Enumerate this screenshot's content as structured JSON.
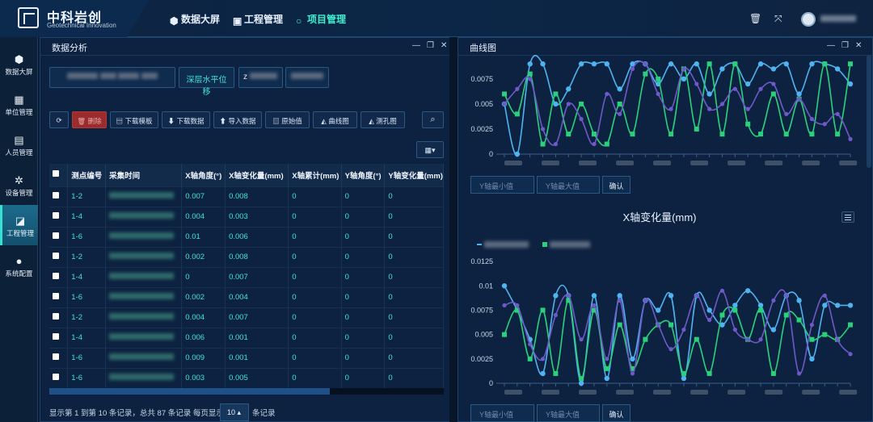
{
  "app": {
    "title": "中科岩创",
    "subtitle": "Geotechnical Innovation"
  },
  "nav": [
    {
      "label": "数据大屏",
      "icon": "cube-icon"
    },
    {
      "label": "工程管理",
      "icon": "monitor-icon"
    },
    {
      "label": "项目管理",
      "icon": "circle-icon",
      "active": true
    }
  ],
  "sidebar": [
    {
      "label": "数据大屏",
      "icon": "cube-icon"
    },
    {
      "label": "单位管理",
      "icon": "calendar-icon"
    },
    {
      "label": "人员管理",
      "icon": "person-card-icon"
    },
    {
      "label": "设备管理",
      "icon": "gear-icon"
    },
    {
      "label": "工程管理",
      "icon": "chart-icon",
      "active": true
    },
    {
      "label": "系统配置",
      "icon": "dots-icon"
    }
  ],
  "left_panel": {
    "title": "数据分析",
    "filter_mid": "深层水平位移",
    "filter_z": "z",
    "buttons": {
      "refresh": "⟳",
      "delete": "删除",
      "download_template": "下载模板",
      "download_data": "下载数据",
      "import_data": "导入数据",
      "raw_values": "原始值",
      "curve": "曲线图",
      "hole": "测孔图"
    },
    "columns": [
      "测点编号",
      "采集时间",
      "X轴角度(°)",
      "X轴变化量(mm)",
      "X轴累计(mm)",
      "Y轴角度(°)",
      "Y轴变化量(mm)"
    ],
    "rows": [
      [
        "1-2",
        "0.007",
        "0.008",
        "0",
        "0",
        "0"
      ],
      [
        "1-4",
        "0.004",
        "0.003",
        "0",
        "0",
        "0"
      ],
      [
        "1-6",
        "0.01",
        "0.006",
        "0",
        "0",
        "0"
      ],
      [
        "1-2",
        "0.002",
        "0.008",
        "0",
        "0",
        "0"
      ],
      [
        "1-4",
        "0",
        "0.007",
        "0",
        "0",
        "0"
      ],
      [
        "1-6",
        "0.002",
        "0.004",
        "0",
        "0",
        "0"
      ],
      [
        "1-2",
        "0.004",
        "0.007",
        "0",
        "0",
        "0"
      ],
      [
        "1-4",
        "0.006",
        "0.001",
        "0",
        "0",
        "0"
      ],
      [
        "1-6",
        "0.009",
        "0.001",
        "0",
        "0",
        "0"
      ],
      [
        "1-6",
        "0.003",
        "0.005",
        "0",
        "0",
        "0"
      ]
    ],
    "pager": {
      "text_before": "显示第 1 到第 10 条记录，总共 87 条记录 每页显示",
      "page_size": "10",
      "text_after": "条记录"
    }
  },
  "right_panel": {
    "title": "曲线图",
    "y_min_placeholder": "Y轴最小值",
    "y_max_placeholder": "Y轴最大值",
    "confirm": "确认",
    "chart2_title": "X轴变化量(mm)"
  },
  "chart_data": [
    {
      "type": "line",
      "title": "",
      "y_ticks": [
        "0",
        "0.0025",
        "0.005",
        "0.0075"
      ],
      "ylim": [
        0,
        0.0095
      ],
      "series": [
        {
          "color": "#4fb3f0",
          "values": [
            0.005,
            0,
            0.009,
            0.009,
            0.005,
            0.0065,
            0.009,
            0.009,
            0.009,
            0.0065,
            0.009,
            0.009,
            0.007,
            0.009,
            0.0075,
            0.009,
            0.006,
            0.0085,
            0.009,
            0.007,
            0.009,
            0.0085,
            0.009,
            0.006,
            0.009,
            0.009,
            0.0085,
            0.007
          ]
        },
        {
          "color": "#2ad17a",
          "values": [
            0.006,
            0.004,
            0.008,
            0.001,
            0.006,
            0.002,
            0.005,
            0.002,
            0.001,
            0.005,
            0.002,
            0.008,
            0.0075,
            0.002,
            0.0085,
            0.0025,
            0.009,
            0.002,
            0.009,
            0.003,
            0.002,
            0.006,
            0.002,
            0.0055,
            0.002,
            0.009,
            0.002,
            0.009
          ]
        },
        {
          "color": "#6f59c8",
          "values": [
            0.005,
            0.0065,
            0.0075,
            0.0025,
            0.001,
            0.005,
            0.0035,
            0.001,
            0.006,
            0.004,
            0.0085,
            0.009,
            0.006,
            0.0045,
            0.0085,
            0.007,
            0.0045,
            0.005,
            0.0065,
            0.0045,
            0.0065,
            0.007,
            0.004,
            0.0055,
            0.0035,
            0.003,
            0.004,
            0.0015
          ]
        }
      ]
    },
    {
      "type": "line",
      "title": "X轴变化量(mm)",
      "y_ticks": [
        "0",
        "0.0025",
        "0.005",
        "0.0075",
        "0.01",
        "0.0125"
      ],
      "ylim": [
        0,
        0.0135
      ],
      "series": [
        {
          "color": "#4fb3f0",
          "values": [
            0.01,
            0.0075,
            0.0045,
            0.001,
            0.009,
            0.009,
            0,
            0.009,
            0.0005,
            0.009,
            0.0025,
            0.0085,
            0.0075,
            0.009,
            0.0005,
            0.009,
            0.0075,
            0.006,
            0.008,
            0.0095,
            0.008,
            0.0055,
            0.009,
            0.0085,
            0.0025,
            0.008,
            0.008,
            0.008
          ]
        },
        {
          "color": "#2ad17a",
          "values": [
            0.005,
            0.0075,
            0.0025,
            0.0075,
            0.001,
            0.0085,
            0.0005,
            0.0075,
            0.0015,
            0.006,
            0.0015,
            0.0045,
            0.006,
            0.006,
            0.001,
            0.0045,
            0.001,
            0.007,
            0.0075,
            0.0045,
            0.0075,
            0.001,
            0.007,
            0.0065,
            0.0045,
            0.005,
            0.0045,
            0.006
          ]
        },
        {
          "color": "#6f59c8",
          "values": [
            0.008,
            0.008,
            0.004,
            0.0025,
            0.007,
            0.009,
            0.0045,
            0.008,
            0.0025,
            0.0085,
            0.001,
            0.0085,
            0.006,
            0.0035,
            0.0055,
            0.009,
            0.0065,
            0.0095,
            0.0055,
            0.0045,
            0.0045,
            0.0085,
            0.009,
            0.001,
            0.006,
            0.009,
            0.0045,
            0.003
          ]
        }
      ]
    }
  ]
}
